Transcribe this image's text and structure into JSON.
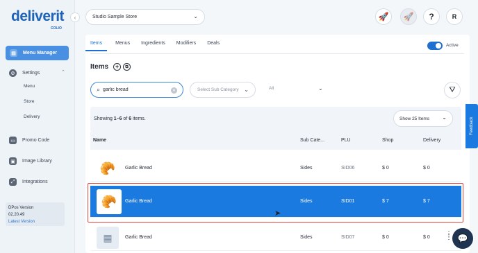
{
  "brand": {
    "name": "deliverit",
    "sub": "COLIO",
    "accent": "#1e6fd0",
    "danger": "#e0443a"
  },
  "sidebar": {
    "collapse_icon": "chevron-left-icon",
    "active": {
      "label": "Menu Manager",
      "icon": "menu-manager-icon"
    },
    "settings": {
      "label": "Settings",
      "icon": "gear-icon",
      "children": [
        "Menu",
        "Store",
        "Delivery"
      ]
    },
    "items": [
      {
        "label": "Promo Code",
        "icon": "promo-code-icon"
      },
      {
        "label": "Image Library",
        "icon": "image-library-icon"
      },
      {
        "label": "Integrations",
        "icon": "integrations-icon"
      }
    ],
    "version": {
      "label": "DPos Version",
      "number": "02.20.49",
      "link": "Latest Version"
    }
  },
  "header": {
    "store": "Studio Sample Store",
    "buttons": [
      {
        "icon": "rocket-icon"
      },
      {
        "icon": "rocket-outline-icon"
      },
      {
        "icon": "help-icon",
        "glyph": "?"
      },
      {
        "icon": "avatar",
        "glyph": "R"
      }
    ]
  },
  "tabs": [
    "Items",
    "Menus",
    "Ingredients",
    "Modifiers",
    "Deals"
  ],
  "active_tab": "Items",
  "active_toggle": {
    "label": "Active",
    "on": true
  },
  "items_title": "Items",
  "filters": {
    "search_value": "garlic bread",
    "subcategory_placeholder": "Select Sub Category",
    "status_value": "All"
  },
  "showing": {
    "prefix": "Showing ",
    "range": "1–6",
    "of": " of ",
    "total": "6",
    "suffix": " items."
  },
  "page_size": "Show 25 Items",
  "table": {
    "headers": {
      "name": "Name",
      "sub": "Sub Cate...",
      "plu": "PLU",
      "shop": "Shop",
      "delivery": "Delivery"
    },
    "rows": [
      {
        "name": "Garlic Bread",
        "sub": "Sides",
        "plu": "SID06",
        "shop": "$ 0",
        "delivery": "$ 0"
      },
      {
        "name": "Garlic Bread",
        "sub": "Sides",
        "plu": "SID01",
        "shop": "$ 7",
        "delivery": "$ 7"
      },
      {
        "name": "Garlic Bread",
        "sub": "Sides",
        "plu": "SID07",
        "shop": "$ 0",
        "delivery": "$ 0"
      }
    ]
  },
  "feedback": "Feedback"
}
